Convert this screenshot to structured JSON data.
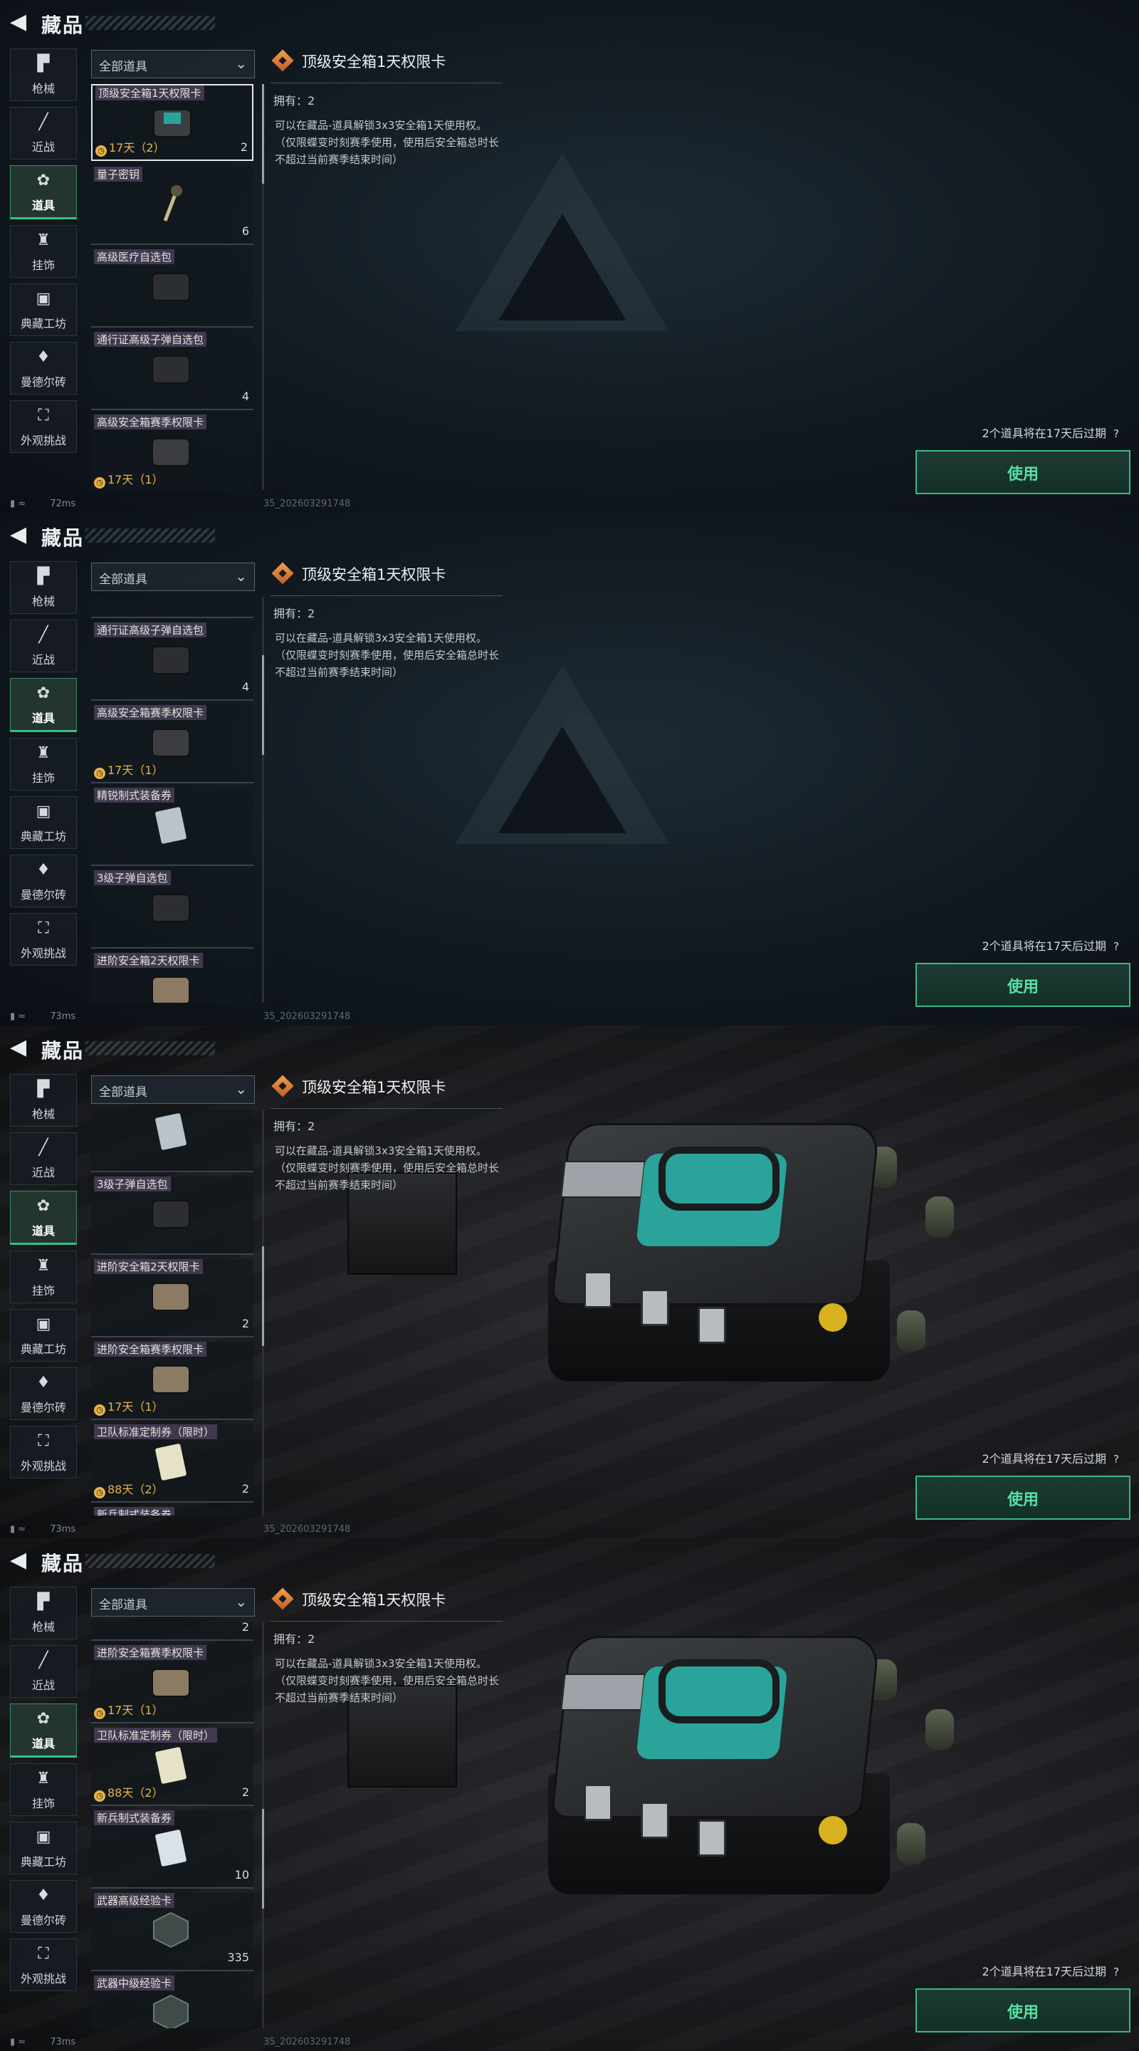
{
  "header": {
    "back_icon": "back-arrow-icon",
    "title": "藏品"
  },
  "tabs": [
    {
      "label": "枪械",
      "icon": "gun-icon",
      "active": false
    },
    {
      "label": "近战",
      "icon": "knife-icon",
      "active": false
    },
    {
      "label": "道具",
      "icon": "items-icon",
      "active": true
    },
    {
      "label": "挂饰",
      "icon": "charm-icon",
      "active": false
    },
    {
      "label": "典藏工坊",
      "icon": "workshop-icon",
      "active": false
    },
    {
      "label": "曼德尔砖",
      "icon": "brick-icon",
      "active": false
    },
    {
      "label": "外观挑战",
      "icon": "challenge-icon",
      "active": false
    }
  ],
  "filter": {
    "label": "全部道具"
  },
  "detail": {
    "title": "顶级安全箱1天权限卡",
    "owned": "拥有：2",
    "description": "可以在藏品-道具解锁3x3安全箱1天使用权。（仅限蝶变时刻赛季使用，使用后安全箱总时长不超过当前赛季结束时间）",
    "expire_notice": "2个道具将在17天后过期",
    "help": "?",
    "use_button": "使用"
  },
  "items": [
    {
      "name": "顶级安全箱1天权限卡",
      "count": "2",
      "timer": "17天（2）"
    },
    {
      "name": "量子密钥",
      "count": "6",
      "timer": ""
    },
    {
      "name": "高级医疗自选包",
      "count": "",
      "timer": ""
    },
    {
      "name": "通行证高级子弹自选包",
      "count": "4",
      "timer": ""
    },
    {
      "name": "高级安全箱赛季权限卡",
      "count": "",
      "timer": "17天（1）"
    },
    {
      "name": "精锐制式装备券",
      "count": "",
      "timer": ""
    },
    {
      "name": "3级子弹自选包",
      "count": "",
      "timer": ""
    },
    {
      "name": "进阶安全箱2天权限卡",
      "count": "2",
      "timer": ""
    },
    {
      "name": "进阶安全箱赛季权限卡",
      "count": "",
      "timer": "17天（1）"
    },
    {
      "name": "卫队标准定制券（限时）",
      "count": "2",
      "timer": "88天（2）"
    },
    {
      "name": "新兵制式装备券",
      "count": "10",
      "timer": ""
    },
    {
      "name": "武器高级经验卡",
      "count": "335",
      "timer": ""
    },
    {
      "name": "武器中级经验卡",
      "count": "",
      "timer": ""
    }
  ],
  "status": [
    {
      "ping": "72ms",
      "id": "35_202603291748"
    },
    {
      "ping": "73ms",
      "id": "35_202603291748"
    },
    {
      "ping": "73ms",
      "id": "35_202603291748"
    },
    {
      "ping": "73ms",
      "id": "35_202603291748"
    }
  ],
  "colors": {
    "accent": "#36c08a",
    "timer": "#e8b348",
    "highlight_border": "#e9e9e9"
  }
}
